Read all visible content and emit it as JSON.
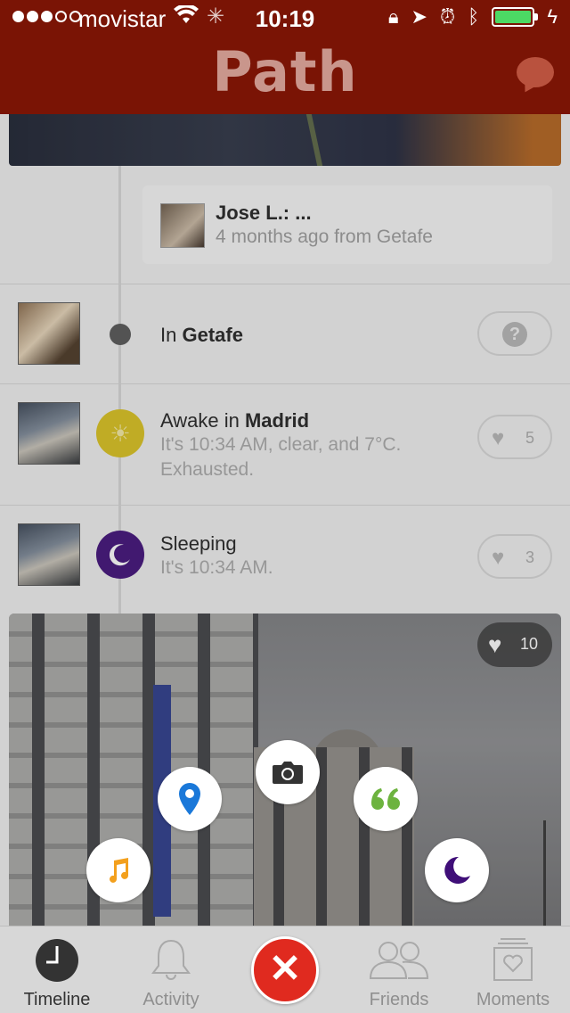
{
  "status_bar": {
    "carrier": "movistar",
    "time": "10:19",
    "signal_bars_filled": 3,
    "signal_bars_total": 5,
    "battery_level": 1.0
  },
  "nav": {
    "title": "Path"
  },
  "comment": {
    "author": "Jose L.: ...",
    "meta": "4 months ago from Getafe"
  },
  "moments": [
    {
      "prefix": "In ",
      "place": "Getafe",
      "subtitle": "",
      "likes": ""
    },
    {
      "prefix": "Awake in ",
      "place": "Madrid",
      "subtitle": "It's 10:34 AM, clear, and 7°C. Exhausted.",
      "likes": "5"
    },
    {
      "prefix": "Sleeping",
      "place": "",
      "subtitle": "It's 10:34 AM.",
      "likes": "3"
    }
  ],
  "photo": {
    "likes": "10"
  },
  "quick_add": [
    "music",
    "place",
    "photo",
    "thought",
    "sleep"
  ],
  "tabs": [
    {
      "label": "Timeline",
      "active": true
    },
    {
      "label": "Activity",
      "active": false
    },
    {
      "label": "Friends",
      "active": false
    },
    {
      "label": "Moments",
      "active": false
    }
  ],
  "colors": {
    "nav_bar": "#7a1405",
    "close_button": "#e02a1f",
    "awake_icon": "#d9c11d",
    "sleep_icon": "#3f0e78",
    "music_icon": "#f3a01d",
    "place_icon": "#1a78d9",
    "thought_icon": "#6db33f",
    "battery": "#4cd964"
  }
}
